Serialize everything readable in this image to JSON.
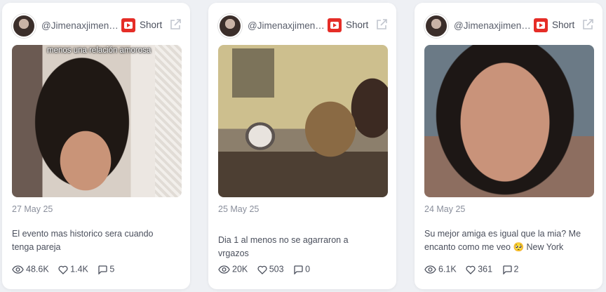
{
  "posts": [
    {
      "handle": "@Jimenaxjimenax",
      "type": "Short",
      "caption_overlay": "menos una relación amorosa",
      "date": "27 May 25",
      "description": "El evento mas historico sera cuando tenga pareja",
      "views": "48.6K",
      "likes": "1.4K",
      "comments": "5"
    },
    {
      "handle": "@Jimenaxjimenax",
      "type": "Short",
      "caption_overlay": "",
      "date": "25 May 25",
      "description": "Dia 1 al menos no se agarraron a vrgazos",
      "views": "20K",
      "likes": "503",
      "comments": "0"
    },
    {
      "handle": "@Jimenaxjimenax",
      "type": "Short",
      "caption_overlay": "",
      "date": "24 May 25",
      "description": "Su mejor amiga es igual que la mia? Me encanto como me veo 🥺 New York",
      "views": "6.1K",
      "likes": "361",
      "comments": "2"
    }
  ],
  "icons": {
    "platform": "youtube-icon",
    "external": "external-link-icon",
    "views": "eye-icon",
    "likes": "heart-icon",
    "comments": "comment-icon"
  },
  "colors": {
    "youtube_red": "#e52d27",
    "card_bg": "#ffffff",
    "page_bg": "#eef0f4"
  }
}
